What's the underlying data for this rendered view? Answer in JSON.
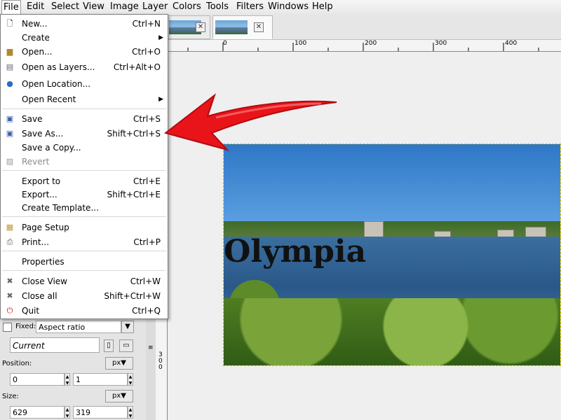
{
  "menubar": [
    "File",
    "Edit",
    "Select",
    "View",
    "Image",
    "Layer",
    "Colors",
    "Tools",
    "Filters",
    "Windows",
    "Help"
  ],
  "file_menu": [
    {
      "label": "New...",
      "shortcut": "Ctrl+N",
      "icon": "new-file-icon"
    },
    {
      "label": "Create",
      "shortcut": "",
      "submenu": true
    },
    {
      "label": "Open...",
      "shortcut": "Ctrl+O",
      "icon": "open-folder-icon"
    },
    {
      "label": "Open as Layers...",
      "shortcut": "Ctrl+Alt+O",
      "icon": "layers-icon"
    },
    {
      "label": "Open Location...",
      "shortcut": "",
      "icon": "globe-icon"
    },
    {
      "label": "Open Recent",
      "shortcut": "",
      "submenu": true
    },
    {
      "label": "Save",
      "shortcut": "Ctrl+S",
      "icon": "save-icon"
    },
    {
      "label": "Save As...",
      "shortcut": "Shift+Ctrl+S",
      "icon": "save-as-icon"
    },
    {
      "label": "Save a Copy...",
      "shortcut": ""
    },
    {
      "label": "Revert",
      "shortcut": "",
      "icon": "revert-icon",
      "disabled": true
    },
    {
      "label": "Export to",
      "shortcut": "Ctrl+E"
    },
    {
      "label": "Export...",
      "shortcut": "Shift+Ctrl+E"
    },
    {
      "label": "Create Template...",
      "shortcut": ""
    },
    {
      "label": "Page Setup",
      "shortcut": "",
      "icon": "page-setup-icon"
    },
    {
      "label": "Print...",
      "shortcut": "Ctrl+P",
      "icon": "print-icon"
    },
    {
      "label": "Properties",
      "shortcut": ""
    },
    {
      "label": "Close View",
      "shortcut": "Ctrl+W",
      "icon": "close-view-icon"
    },
    {
      "label": "Close all",
      "shortcut": "Shift+Ctrl+W",
      "icon": "close-all-icon"
    },
    {
      "label": "Quit",
      "shortcut": "Ctrl+Q",
      "icon": "quit-icon"
    }
  ],
  "ruler": [
    "0",
    "100",
    "200",
    "300",
    "400"
  ],
  "ruler_left": "300",
  "canvas_text": "Olympia",
  "tool_options": {
    "fixed_label": "Fixed:",
    "fixed_value": "Aspect ratio",
    "current": "Current",
    "position_label": "Position:",
    "position_unit": "px",
    "pos_x": "0",
    "pos_y": "1",
    "size_label": "Size:",
    "size_unit": "px",
    "size_w": "629",
    "size_h": "319"
  },
  "colors": {
    "arrow": "#e8141a",
    "menu_bg": "#ffffff",
    "selection_border": "#d8c400"
  }
}
